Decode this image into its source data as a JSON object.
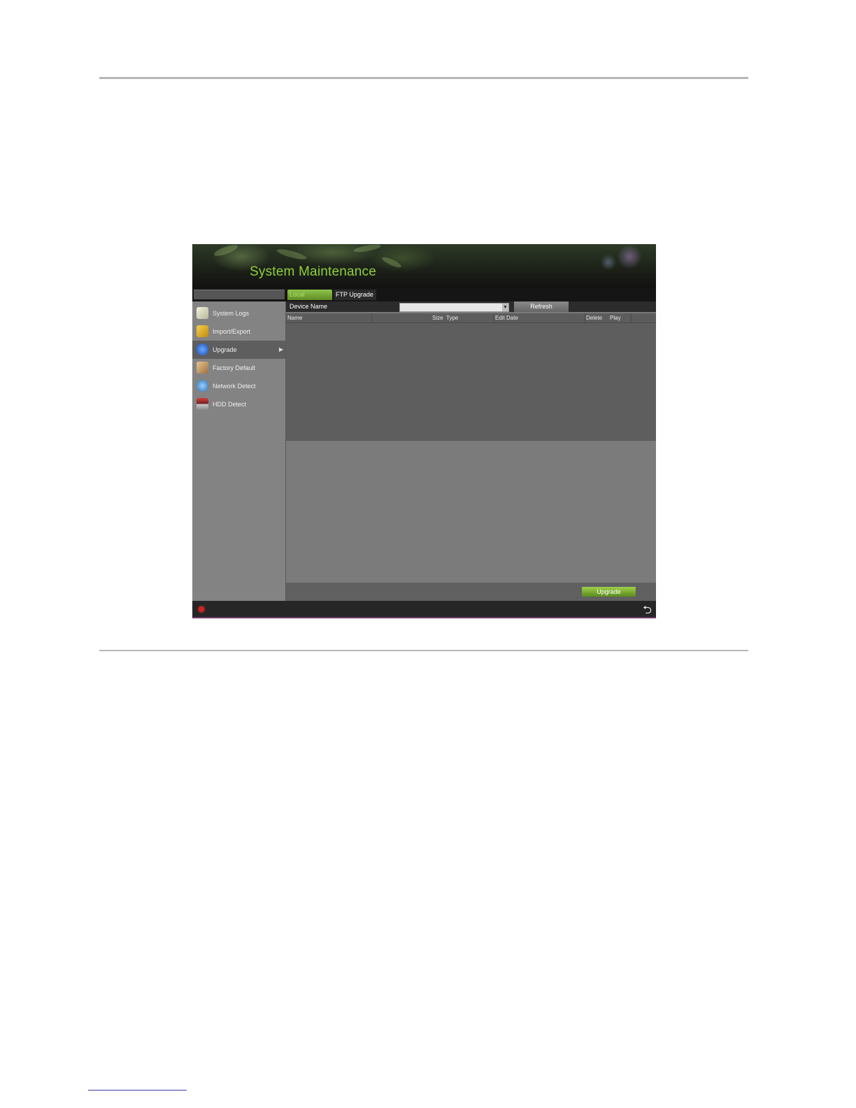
{
  "window": {
    "title": "System Maintenance"
  },
  "tabs": [
    {
      "label": "Local Upgrade",
      "active": true
    },
    {
      "label": "FTP Upgrade",
      "active": false
    }
  ],
  "sidebar": {
    "items": [
      {
        "label": "System Logs",
        "icon": "document-icon"
      },
      {
        "label": "Import/Export",
        "icon": "folder-icon"
      },
      {
        "label": "Upgrade",
        "icon": "info-icon",
        "selected": true
      },
      {
        "label": "Factory Default",
        "icon": "box-icon"
      },
      {
        "label": "Network Detect",
        "icon": "globe-icon"
      },
      {
        "label": "HDD Detect",
        "icon": "hdd-icon"
      }
    ]
  },
  "device": {
    "label": "Device Name",
    "selected_value": "",
    "refresh_label": "Refresh"
  },
  "table": {
    "columns": [
      "Name",
      "Size",
      "Type",
      "Edit Date",
      "Delete",
      "Play"
    ],
    "rows": []
  },
  "footer": {
    "upgrade_label": "Upgrade"
  },
  "colors": {
    "title_green": "#8fd03a",
    "status_red": "#d82020"
  }
}
